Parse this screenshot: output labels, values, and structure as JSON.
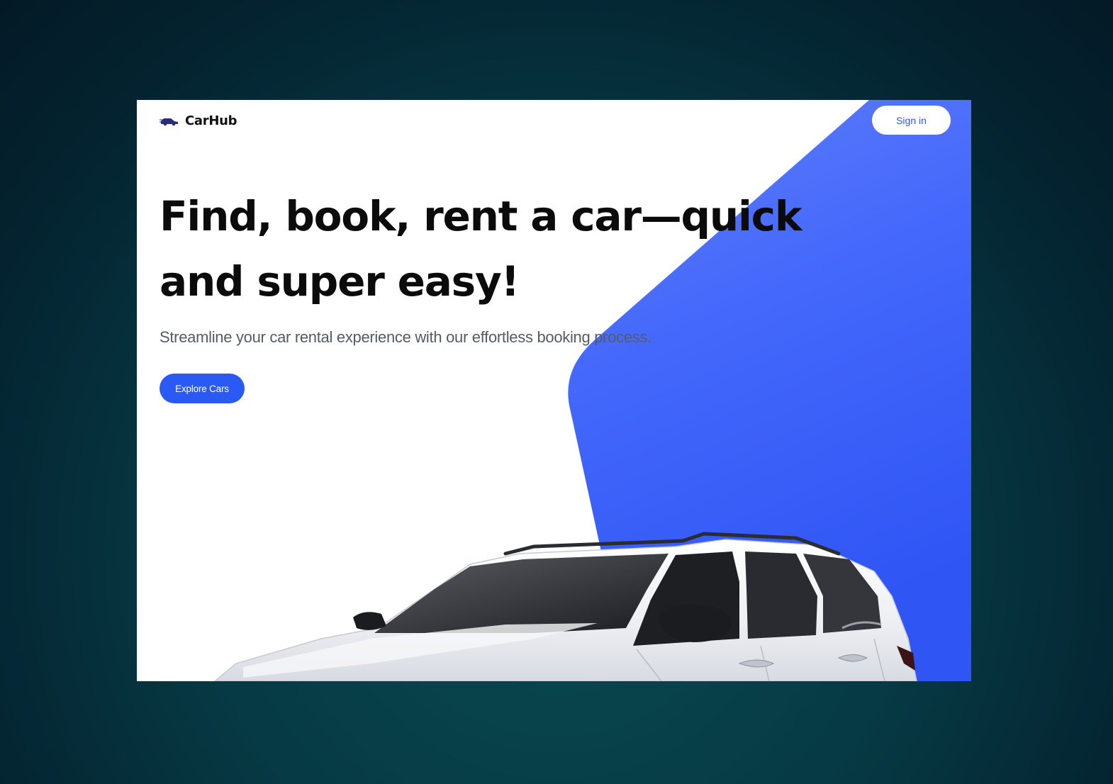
{
  "brand": {
    "name": "CarHub",
    "logo_icon": "car-logo-icon"
  },
  "nav": {
    "signin_label": "Sign in"
  },
  "hero": {
    "title": "Find, book, rent a car—quick and super easy!",
    "subtitle": "Streamline your car rental experience with our effortless booking process.",
    "cta_label": "Explore Cars"
  },
  "colors": {
    "accent": "#2b59f3",
    "background": "#063a44",
    "title": "#0b0b0b"
  },
  "image": {
    "name": "white-suv-image"
  }
}
